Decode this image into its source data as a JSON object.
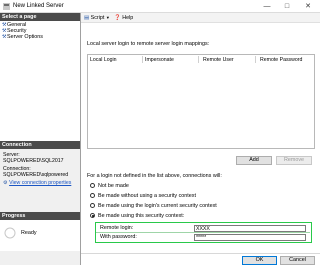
{
  "window": {
    "title": "New Linked Server",
    "controls": {
      "minimize": "—",
      "maximize": "□",
      "close": "✕"
    }
  },
  "left": {
    "select_page_header": "Select a page",
    "pages": [
      {
        "label": "General"
      },
      {
        "label": "Security"
      },
      {
        "label": "Server Options"
      }
    ],
    "connection_header": "Connection",
    "server_label": "Server:",
    "server_value": "SQLPOWERED\\SQL2017",
    "connection_label": "Connection:",
    "connection_value": "SQLPOWERED\\sqlpowered",
    "view_link": "View connection properties",
    "progress_header": "Progress",
    "progress_status": "Ready"
  },
  "toolbar": {
    "script": "Script",
    "help": "Help"
  },
  "main": {
    "mapping_title": "Local server login to remote server login mappings:",
    "columns": [
      "Local Login",
      "Impersonate",
      "Remote User",
      "Remote Password"
    ],
    "add_button": "Add",
    "remove_button": "Remove",
    "fallback_label": "For a login not defined in the list above, connections will:",
    "options": [
      {
        "label": "Not be made",
        "selected": false
      },
      {
        "label": "Be made without using a security context",
        "selected": false
      },
      {
        "label": "Be made using the login's current security context",
        "selected": false
      },
      {
        "label": "Be made using this security context:",
        "selected": true
      }
    ],
    "remote_login_label": "Remote login:",
    "remote_login_value": "XXXX",
    "password_label": "With password:",
    "password_value": "*****"
  },
  "footer": {
    "ok": "OK",
    "cancel": "Cancel"
  },
  "colors": {
    "highlight": "#29c94a",
    "header_bg": "#4b4b4b",
    "link": "#1a55c4"
  }
}
